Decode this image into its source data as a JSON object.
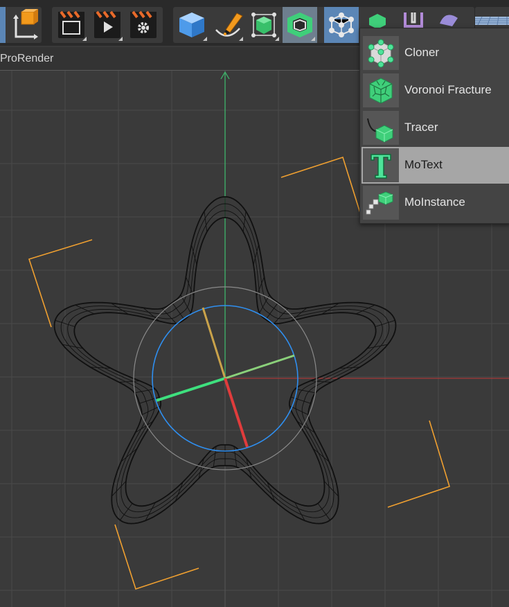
{
  "viewport": {
    "label": "ProRender"
  },
  "mograph_menu": {
    "items": [
      {
        "label": "Cloner",
        "icon": "cloner-icon"
      },
      {
        "label": "Voronoi Fracture",
        "icon": "voronoi-fracture-icon"
      },
      {
        "label": "Tracer",
        "icon": "tracer-icon"
      },
      {
        "label": "MoText",
        "icon": "motext-icon",
        "highlighted": true
      },
      {
        "label": "MoInstance",
        "icon": "moinstance-icon"
      }
    ]
  },
  "colors": {
    "toolbar_bg": "#2a2a2a",
    "viewport_bg": "#3a3a3a",
    "grid": "#4a4a4a",
    "y_axis": "#3fbf6f",
    "x_axis": "#c03838",
    "gizmo_ring": "#2f8ff0",
    "spline_bracket": "#f0a030",
    "mograph_green": "#4ee39a",
    "menu_highlight": "#a6a6a6"
  },
  "toolbar_icons": [
    "coordinate-system-icon",
    "render-region-icon",
    "render-view-icon",
    "render-settings-icon",
    "cube-icon",
    "pen-spline-icon",
    "subdivision-surface-icon",
    "extrude-icon",
    "mograph-cloner-icon",
    "mograph-effector-icon",
    "deformer-icon",
    "scene-icon",
    "floor-icon"
  ]
}
